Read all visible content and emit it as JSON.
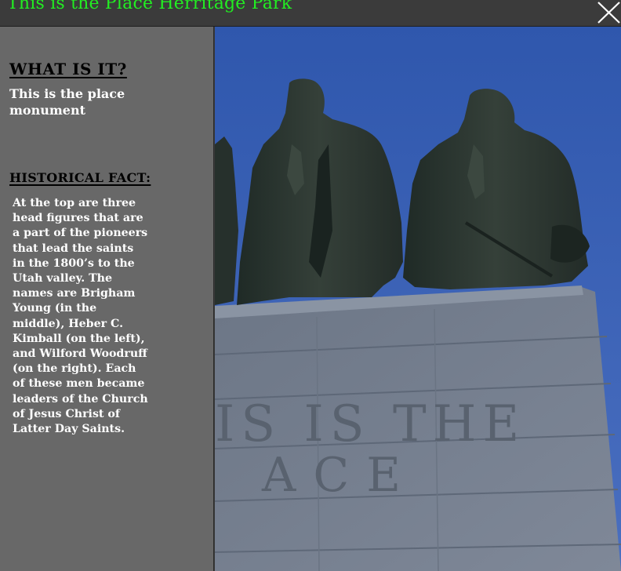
{
  "window": {
    "title": "This is the Place Herritage Park",
    "title_color": "#22ee22",
    "close_icon": "close-icon"
  },
  "sidebar": {
    "what_heading": "WHAT IS IT?",
    "what_text": "This is the place monument",
    "fact_heading": "HISTORICAL FACT:",
    "fact_text": "At the top are three\nhead figures that are\na part of the pioneers\nthat lead the saints\nin the 1800’s to the\nUtah valley.  The\nnames are Brigham\nYoung (in the\nmiddle), Heber C.\nKimball (on the left),\nand Wilford Woodruff\n(on the right). Each\nof these men became\nleaders of the Church\nof Jesus Christ of\nLatter Day Saints."
  },
  "photo": {
    "inscription_line1": "IS IS THE",
    "inscription_line2": "ACE"
  }
}
